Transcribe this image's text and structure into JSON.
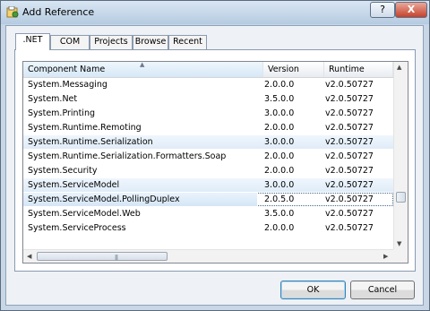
{
  "window": {
    "title": "Add Reference",
    "help_label": "?",
    "close_label": "X"
  },
  "tabs": [
    ".NET",
    "COM",
    "Projects",
    "Browse",
    "Recent"
  ],
  "list": {
    "columns": [
      "Component Name",
      "Version",
      "Runtime"
    ],
    "rows": [
      {
        "name": "System.Messaging",
        "version": "2.0.0.0",
        "runtime": "v2.0.50727"
      },
      {
        "name": "System.Net",
        "version": "3.5.0.0",
        "runtime": "v2.0.50727"
      },
      {
        "name": "System.Printing",
        "version": "3.0.0.0",
        "runtime": "v2.0.50727"
      },
      {
        "name": "System.Runtime.Remoting",
        "version": "2.0.0.0",
        "runtime": "v2.0.50727"
      },
      {
        "name": "System.Runtime.Serialization",
        "version": "3.0.0.0",
        "runtime": "v2.0.50727"
      },
      {
        "name": "System.Runtime.Serialization.Formatters.Soap",
        "version": "2.0.0.0",
        "runtime": "v2.0.50727"
      },
      {
        "name": "System.Security",
        "version": "2.0.0.0",
        "runtime": "v2.0.50727"
      },
      {
        "name": "System.ServiceModel",
        "version": "3.0.0.0",
        "runtime": "v2.0.50727"
      },
      {
        "name": "System.ServiceModel.PollingDuplex",
        "version": "2.0.5.0",
        "runtime": "v2.0.50727"
      },
      {
        "name": "System.ServiceModel.Web",
        "version": "3.5.0.0",
        "runtime": "v2.0.50727"
      },
      {
        "name": "System.ServiceProcess",
        "version": "2.0.0.0",
        "runtime": "v2.0.50727"
      }
    ]
  },
  "buttons": {
    "ok": "OK",
    "cancel": "Cancel"
  }
}
